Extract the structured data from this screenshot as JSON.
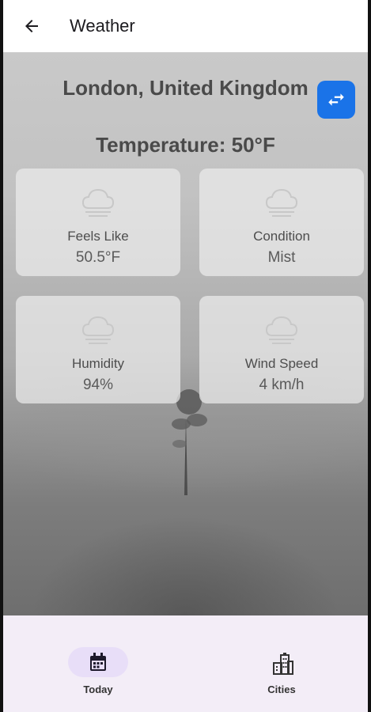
{
  "appbar": {
    "title": "Weather",
    "back_icon": "arrow-back-icon"
  },
  "location": {
    "city": "London, United Kingdom",
    "swap_icon": "swap-horiz-icon"
  },
  "temperature": "Temperature: 50°F",
  "cards": [
    {
      "label": "Feels Like",
      "value": "50.5°F",
      "icon": "cloud-icon"
    },
    {
      "label": "Condition",
      "value": "Mist",
      "icon": "cloud-icon"
    },
    {
      "label": "Humidity",
      "value": "94%",
      "icon": "cloud-icon"
    },
    {
      "label": "Wind Speed",
      "value": "4 km/h",
      "icon": "cloud-icon"
    }
  ],
  "bottom_nav": {
    "items": [
      {
        "label": "Today",
        "icon": "calendar-icon",
        "selected": true
      },
      {
        "label": "Cities",
        "icon": "city-icon",
        "selected": false
      }
    ]
  },
  "colors": {
    "accent": "#1a73e8",
    "nav_bg": "#f3edf7",
    "nav_selected": "#e8def8"
  }
}
